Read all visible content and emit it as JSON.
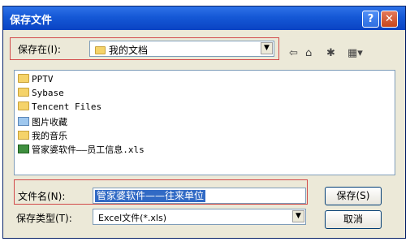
{
  "window": {
    "title": "保存文件",
    "help_label": "?",
    "close_label": "✕"
  },
  "save_in": {
    "label": "保存在(I):",
    "value": "我的文档"
  },
  "toolbar": {
    "icons": [
      "back-icon",
      "up-folder-icon",
      "new-folder-icon",
      "view-menu-icon"
    ]
  },
  "file_list": [
    {
      "name": "PPTV",
      "icon": "folder-icon"
    },
    {
      "name": "Sybase",
      "icon": "folder-icon"
    },
    {
      "name": "Tencent Files",
      "icon": "folder-icon"
    },
    {
      "name": "图片收藏",
      "icon": "pictures-folder-icon"
    },
    {
      "name": "我的音乐",
      "icon": "music-folder-icon"
    },
    {
      "name": "管家婆软件——员工信息.xls",
      "icon": "excel-file-icon"
    }
  ],
  "filename": {
    "label": "文件名(N):",
    "value": "管家婆软件——往来单位"
  },
  "filetype": {
    "label": "保存类型(T):",
    "value": "Excel文件(*.xls)"
  },
  "buttons": {
    "save": "保存(S)",
    "cancel": "取消"
  },
  "colors": {
    "highlight_box": "#d24a4a",
    "selection": "#316ac5",
    "title_bar": "#1558d6"
  }
}
